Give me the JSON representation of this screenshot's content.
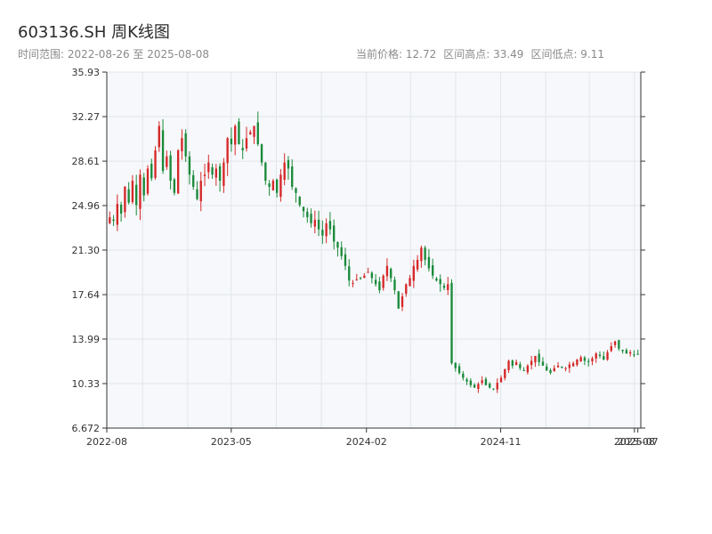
{
  "header": {
    "title": "603136.SH 周K线图",
    "range": "时间范围: 2022-08-26 至 2025-08-08",
    "current_price": "当前价格: 12.72",
    "high": "区间高点: 33.49",
    "low": "区间低点: 9.11"
  },
  "colors": {
    "up": "#d62728",
    "down": "#1a8a3a",
    "plot_bg": "#f6f8fb",
    "grid": "#e3e6ea",
    "axis": "#333333"
  },
  "chart_data": {
    "type": "candlestick",
    "title": "603136.SH 周K线图",
    "xlabel": "",
    "ylabel": "",
    "ylim": [
      6.672,
      35.93
    ],
    "xlim": [
      "2022-08-20",
      "2025-08-14"
    ],
    "y_ticks": [
      "6.672",
      "10.33",
      "13.99",
      "17.64",
      "21.30",
      "24.96",
      "28.61",
      "32.27",
      "35.93"
    ],
    "x_ticks": [
      {
        "date": "2022-08-01",
        "label": "2022-08"
      },
      {
        "date": "2023-05-01",
        "label": "2023-05"
      },
      {
        "date": "2024-02-01",
        "label": "2024-02"
      },
      {
        "date": "2024-11-01",
        "label": "2024-11"
      },
      {
        "date": "2025-08-01",
        "label": "2025-08"
      },
      {
        "date": "2025-08-08",
        "label": "2025-07"
      }
    ],
    "grid": true,
    "start_date": "2022-08-26",
    "end_date": "2025-08-08",
    "weekly_closes": [
      24.0,
      23.7,
      25.1,
      24.3,
      26.5,
      25.2,
      27.0,
      25.0,
      27.5,
      25.8,
      28.0,
      27.2,
      29.5,
      31.5,
      27.8,
      29.0,
      27.0,
      26.0,
      29.5,
      30.5,
      29.0,
      27.5,
      26.5,
      25.5,
      27.0,
      27.5,
      28.5,
      27.5,
      28.0,
      27.0,
      28.5,
      30.5,
      30.0,
      31.5,
      30.0,
      29.5,
      30.5,
      31.0,
      31.5,
      30.0,
      28.5,
      27.0,
      26.5,
      27.0,
      26.0,
      27.5,
      28.5,
      28.0,
      26.5,
      26.0,
      25.0,
      24.5,
      24.0,
      23.5,
      23.8,
      23.0,
      22.5,
      23.5,
      23.0,
      22.0,
      21.5,
      20.8,
      20.0,
      18.8,
      18.6,
      18.9,
      19.0,
      19.2,
      19.5,
      19.0,
      18.5,
      18.0,
      19.2,
      20.0,
      19.0,
      18.0,
      16.5,
      17.5,
      18.5,
      19.0,
      20.0,
      20.5,
      21.5,
      20.5,
      19.8,
      19.2,
      18.8,
      18.5,
      18.2,
      18.5,
      12.0,
      11.6,
      11.2,
      10.8,
      10.5,
      10.2,
      10.0,
      10.3,
      10.6,
      10.2,
      10.0,
      9.9,
      10.4,
      10.8,
      11.5,
      12.2,
      11.8,
      12.1,
      11.6,
      11.4,
      11.8,
      12.2,
      12.6,
      12.1,
      11.8,
      11.4,
      11.2,
      11.6,
      11.8,
      11.7,
      11.6,
      11.9,
      12.0,
      12.3,
      12.5,
      12.2,
      12.1,
      12.4,
      12.8,
      12.6,
      12.3,
      12.9,
      13.4,
      13.8,
      13.2,
      13.0,
      12.8,
      12.9,
      12.7,
      12.72
    ]
  }
}
